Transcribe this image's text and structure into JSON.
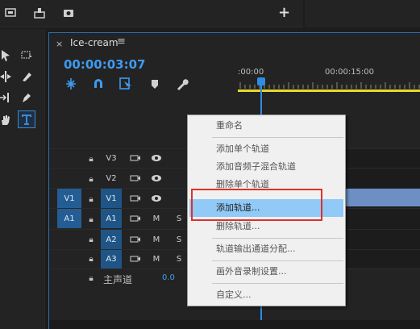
{
  "sequence": {
    "tab_title": "Ice-cream",
    "timecode": "00:00:03:07",
    "ruler_labels": [
      ":00:00",
      "00:00:15:00"
    ]
  },
  "icons": {
    "toolbar": [
      "export-frame-icon",
      "import-icon",
      "camera-icon",
      "add-icon"
    ],
    "tools": [
      "selection-tool-icon",
      "track-select-icon",
      "ripple-edit-icon",
      "razor-tool-icon",
      "slip-tool-icon",
      "pen-tool-icon",
      "hand-tool-icon",
      "type-tool-icon"
    ],
    "timeline_tools": [
      "snap-icon",
      "linked-selection-icon",
      "add-marker-icon",
      "marker-icon",
      "wrench-icon"
    ]
  },
  "tracks": {
    "video": [
      {
        "src": "",
        "target": "V3"
      },
      {
        "src": "",
        "target": "V2"
      },
      {
        "src": "V1",
        "target": "V1"
      }
    ],
    "audio": [
      {
        "src": "A1",
        "target": "A1",
        "m": "M",
        "s": "S"
      },
      {
        "src": "",
        "target": "A2",
        "m": "M",
        "s": "S"
      },
      {
        "src": "",
        "target": "A3",
        "m": "M",
        "s": "S"
      }
    ],
    "master": {
      "label": "主声道",
      "value": "0.0"
    }
  },
  "context_menu": {
    "items": [
      {
        "label": "重命名"
      },
      {
        "label": "添加单个轨道"
      },
      {
        "label": "添加音频子混合轨道"
      },
      {
        "label": "删除单个轨道"
      },
      {
        "label": "添加轨道..."
      },
      {
        "label": "删除轨道..."
      },
      {
        "label": "轨道输出通道分配..."
      },
      {
        "label": "画外音录制设置..."
      },
      {
        "label": "自定义..."
      }
    ],
    "highlighted": "添加轨道...",
    "annotation_color": "#e0302a",
    "highlight_color": "#91c9f7"
  },
  "colors": {
    "accent": "#2e8de2",
    "timecode": "#3e9bf0",
    "work_area": "#e7d92a",
    "clip": "#6d8fc3"
  }
}
